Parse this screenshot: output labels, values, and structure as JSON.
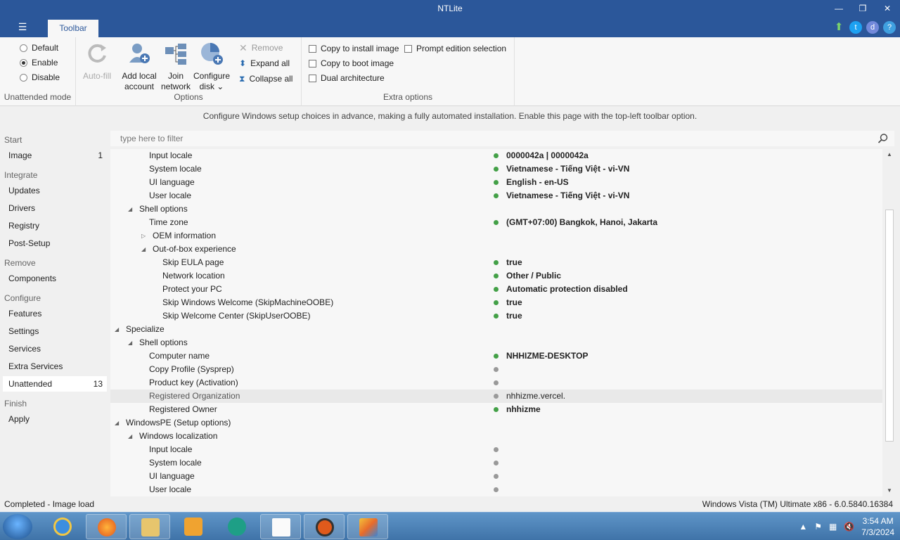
{
  "window": {
    "title": "NTLite",
    "menu_icon": "hamburger-icon",
    "minimize": "—",
    "maximize": "❐",
    "close": "✕"
  },
  "tabs": [
    {
      "label": "Toolbar"
    }
  ],
  "top_right_icons": [
    "update-arrow-icon",
    "twitter-icon",
    "discord-icon",
    "help-icon"
  ],
  "ribbon": {
    "unattended_mode": {
      "label": "Unattended mode",
      "options": [
        {
          "label": "Default",
          "selected": false
        },
        {
          "label": "Enable",
          "selected": true
        },
        {
          "label": "Disable",
          "selected": false
        }
      ]
    },
    "options": {
      "label": "Options",
      "autofill": "Auto-fill",
      "add_local_line1": "Add local",
      "add_local_line2": "account",
      "join_line1": "Join",
      "join_line2": "network",
      "configure_line1": "Configure",
      "configure_line2": "disk",
      "remove": "Remove",
      "expand_all": "Expand all",
      "collapse_all": "Collapse all"
    },
    "extra_options": {
      "label": "Extra options",
      "copy_install": "Copy to install image",
      "copy_boot": "Copy to boot image",
      "dual_arch": "Dual architecture",
      "prompt_edition": "Prompt edition selection"
    }
  },
  "info_text": "Configure Windows setup choices in advance, making a fully automated installation. Enable this page with the top-left toolbar option.",
  "sidebar": {
    "sections": {
      "start": "Start",
      "integrate": "Integrate",
      "remove": "Remove",
      "configure": "Configure",
      "finish": "Finish"
    },
    "items": {
      "image": {
        "label": "Image",
        "count": "1"
      },
      "updates": "Updates",
      "drivers": "Drivers",
      "registry": "Registry",
      "post_setup": "Post-Setup",
      "components": "Components",
      "features": "Features",
      "settings": "Settings",
      "services": "Services",
      "extra_services": "Extra Services",
      "unattended": {
        "label": "Unattended",
        "count": "13"
      },
      "apply": "Apply"
    }
  },
  "filter": {
    "placeholder": "type here to filter"
  },
  "tree": [
    {
      "label": "Input locale",
      "value": "0000042a | 0000042a",
      "dot": "g"
    },
    {
      "label": "System locale",
      "value": "Vietnamese - Tiếng Việt - vi-VN",
      "dot": "g"
    },
    {
      "label": "UI language",
      "value": "English - en-US",
      "dot": "g"
    },
    {
      "label": "User locale",
      "value": "Vietnamese - Tiếng Việt - vi-VN",
      "dot": "g"
    },
    {
      "label": "Shell options",
      "value": "",
      "dot": ""
    },
    {
      "label": "Time zone",
      "value": "(GMT+07:00) Bangkok, Hanoi, Jakarta",
      "dot": "g"
    },
    {
      "label": "OEM information",
      "value": "",
      "dot": ""
    },
    {
      "label": "Out-of-box experience",
      "value": "",
      "dot": ""
    },
    {
      "label": "Skip EULA page",
      "value": "true",
      "dot": "g"
    },
    {
      "label": "Network location",
      "value": "Other / Public",
      "dot": "g"
    },
    {
      "label": "Protect your PC",
      "value": "Automatic protection disabled",
      "dot": "g"
    },
    {
      "label": "Skip Windows Welcome (SkipMachineOOBE)",
      "value": "true",
      "dot": "g"
    },
    {
      "label": "Skip Welcome Center (SkipUserOOBE)",
      "value": "true",
      "dot": "g"
    },
    {
      "label": "Specialize",
      "value": "",
      "dot": ""
    },
    {
      "label": "Shell options",
      "value": "",
      "dot": ""
    },
    {
      "label": "Computer name",
      "value": "NHHIZME-DESKTOP",
      "dot": "g"
    },
    {
      "label": "Copy Profile (Sysprep)",
      "value": "",
      "dot": "x"
    },
    {
      "label": "Product key (Activation)",
      "value": "",
      "dot": "x"
    },
    {
      "label": "Registered Organization",
      "value": "nhhizme.vercel.",
      "dot": "x"
    },
    {
      "label": "Registered Owner",
      "value": "nhhizme",
      "dot": "g"
    },
    {
      "label": "WindowsPE (Setup options)",
      "value": "",
      "dot": ""
    },
    {
      "label": "Windows localization",
      "value": "",
      "dot": ""
    },
    {
      "label": "Input locale",
      "value": "",
      "dot": "x"
    },
    {
      "label": "System locale",
      "value": "",
      "dot": "x"
    },
    {
      "label": "UI language",
      "value": "",
      "dot": "x"
    },
    {
      "label": "User locale",
      "value": "",
      "dot": "x"
    }
  ],
  "status": {
    "left": "Completed - Image load",
    "right": "Windows Vista (TM) Ultimate x86 - 6.0.5840.16384"
  },
  "taskbar": {
    "apps": [
      "internet-explorer-icon",
      "firefox-icon",
      "explorer-icon",
      "media-player-icon",
      "app-icon",
      "notepad-icon",
      "app-icon-2",
      "ntlite-icon"
    ],
    "time": "3:54 AM",
    "date": "7/3/2024"
  }
}
